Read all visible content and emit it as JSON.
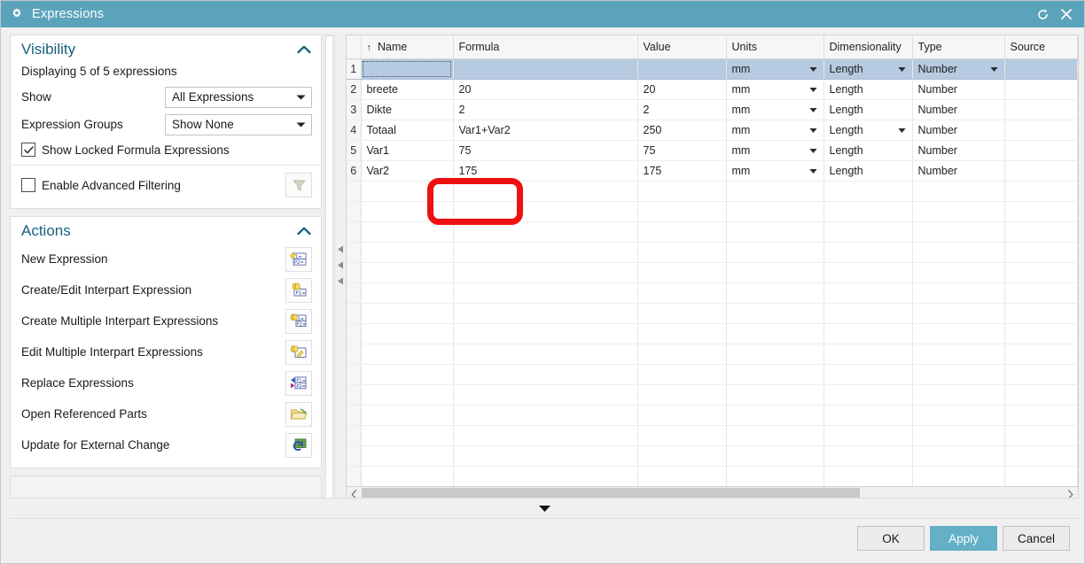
{
  "window": {
    "title": "Expressions",
    "gear_icon": "gear-icon",
    "reset_icon": "reset-icon",
    "close_icon": "close-icon",
    "accent_color": "#5ba3bb",
    "apply_color": "#64b0c6"
  },
  "visibility": {
    "title": "Visibility",
    "collapse_icon": "chevron-up-icon",
    "status": "Displaying 5 of 5 expressions",
    "show_label": "Show",
    "show_value": "All Expressions",
    "groups_label": "Expression Groups",
    "groups_value": "Show None",
    "locked_label": "Show Locked Formula Expressions",
    "locked_checked": true,
    "advanced_label": "Enable Advanced Filtering",
    "advanced_checked": false,
    "filter_icon": "funnel-icon"
  },
  "actions": {
    "title": "Actions",
    "collapse_icon": "chevron-up-icon",
    "items": [
      {
        "label": "New Expression",
        "icon": "new-expression-icon"
      },
      {
        "label": "Create/Edit Interpart Expression",
        "icon": "create-edit-interpart-icon"
      },
      {
        "label": "Create Multiple Interpart Expressions",
        "icon": "create-multiple-interpart-icon"
      },
      {
        "label": "Edit Multiple Interpart Expressions",
        "icon": "edit-multiple-interpart-icon"
      },
      {
        "label": "Replace Expressions",
        "icon": "replace-expressions-icon"
      },
      {
        "label": "Open Referenced Parts",
        "icon": "open-folder-icon"
      },
      {
        "label": "Update for External Change",
        "icon": "update-external-icon"
      }
    ]
  },
  "table": {
    "sort_indicator": "↑",
    "columns": [
      "Name",
      "Formula",
      "Value",
      "Units",
      "Dimensionality",
      "Type",
      "Source"
    ],
    "rows": [
      {
        "num": "1",
        "name": "",
        "formula": "",
        "value": "",
        "units": "mm",
        "dimensionality": "Length",
        "type": "Number",
        "source": "",
        "selected": true,
        "units_dropdown": true,
        "dim_dropdown": true,
        "type_dropdown": true
      },
      {
        "num": "2",
        "name": "breete",
        "formula": "20",
        "value": "20",
        "units": "mm",
        "dimensionality": "Length",
        "type": "Number",
        "source": "",
        "selected": false,
        "units_dropdown": true,
        "dim_dropdown": false,
        "type_dropdown": false
      },
      {
        "num": "3",
        "name": "Dikte",
        "formula": "2",
        "value": "2",
        "units": "mm",
        "dimensionality": "Length",
        "type": "Number",
        "source": "",
        "selected": false,
        "units_dropdown": true,
        "dim_dropdown": false,
        "type_dropdown": false
      },
      {
        "num": "4",
        "name": "Totaal",
        "formula": "Var1+Var2",
        "value": "250",
        "units": "mm",
        "dimensionality": "Length",
        "type": "Number",
        "source": "",
        "selected": false,
        "units_dropdown": true,
        "dim_dropdown": true,
        "type_dropdown": false
      },
      {
        "num": "5",
        "name": "Var1",
        "formula": "75",
        "value": "75",
        "units": "mm",
        "dimensionality": "Length",
        "type": "Number",
        "source": "",
        "selected": false,
        "units_dropdown": true,
        "dim_dropdown": false,
        "type_dropdown": false
      },
      {
        "num": "6",
        "name": "Var2",
        "formula": "175",
        "value": "175",
        "units": "mm",
        "dimensionality": "Length",
        "type": "Number",
        "source": "",
        "selected": false,
        "units_dropdown": true,
        "dim_dropdown": false,
        "type_dropdown": false
      }
    ],
    "empty_rows": 15,
    "hscroll_left_icon": "chevron-left-icon",
    "hscroll_right_icon": "chevron-right-icon"
  },
  "expander": {
    "icon": "caret-down-icon"
  },
  "footer": {
    "ok": "OK",
    "apply": "Apply",
    "cancel": "Cancel"
  },
  "annotation": {
    "color": "#ee1111",
    "shape": "rounded-rectangle"
  }
}
